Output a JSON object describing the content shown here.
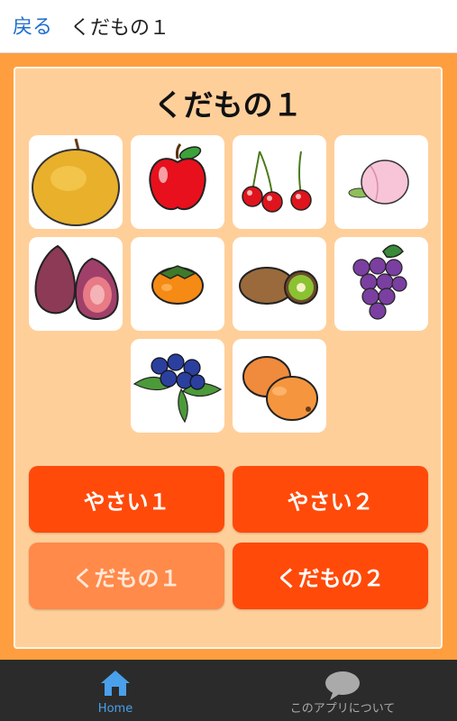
{
  "header": {
    "back_label": "戻る",
    "title": "くだもの１"
  },
  "panel": {
    "title": "くだもの１",
    "items": [
      {
        "icon": "pear-icon"
      },
      {
        "icon": "apple-icon"
      },
      {
        "icon": "cherry-icon"
      },
      {
        "icon": "peach-icon"
      },
      {
        "icon": "fig-icon"
      },
      {
        "icon": "persimmon-icon"
      },
      {
        "icon": "kiwi-icon"
      },
      {
        "icon": "grape-icon"
      },
      {
        "icon": "blueberry-icon"
      },
      {
        "icon": "loquat-icon"
      }
    ]
  },
  "categories": {
    "yasai1": "やさい１",
    "yasai2": "やさい２",
    "kudamono1": "くだもの１",
    "kudamono2": "くだもの２",
    "selected": "kudamono1"
  },
  "bottom_nav": {
    "home_label": "Home",
    "about_label": "このアプリについて"
  },
  "colors": {
    "main_bg": "#ff9e3f",
    "panel_bg": "#ffcf9a",
    "button_active": "#ff4a0a",
    "button_selected": "#ff8a4a",
    "link": "#1e6fd0"
  }
}
